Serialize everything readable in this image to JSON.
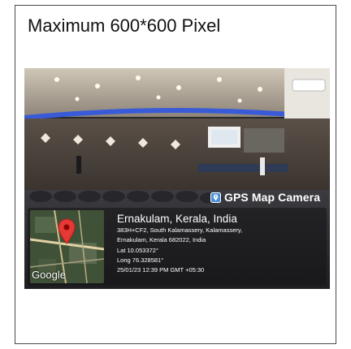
{
  "caption": "Maximum 600*600 Pixel",
  "overlay": {
    "badge_text": "GPS Map Camera",
    "badge_icon": "map-pin-icon",
    "map_logo": "Google",
    "location_title": "Ernakulam, Kerala, India",
    "address_line1": "383H+CF2, South Kalamassery, Kalamassery,",
    "address_line2": "Ernakulam, Kerala 682022, India",
    "lat": "Lat 10.053372°",
    "long": "Long 76.328581°",
    "timestamp": "25/01/23 12:39 PM GMT +05:30",
    "pin_color": "#e53935"
  }
}
